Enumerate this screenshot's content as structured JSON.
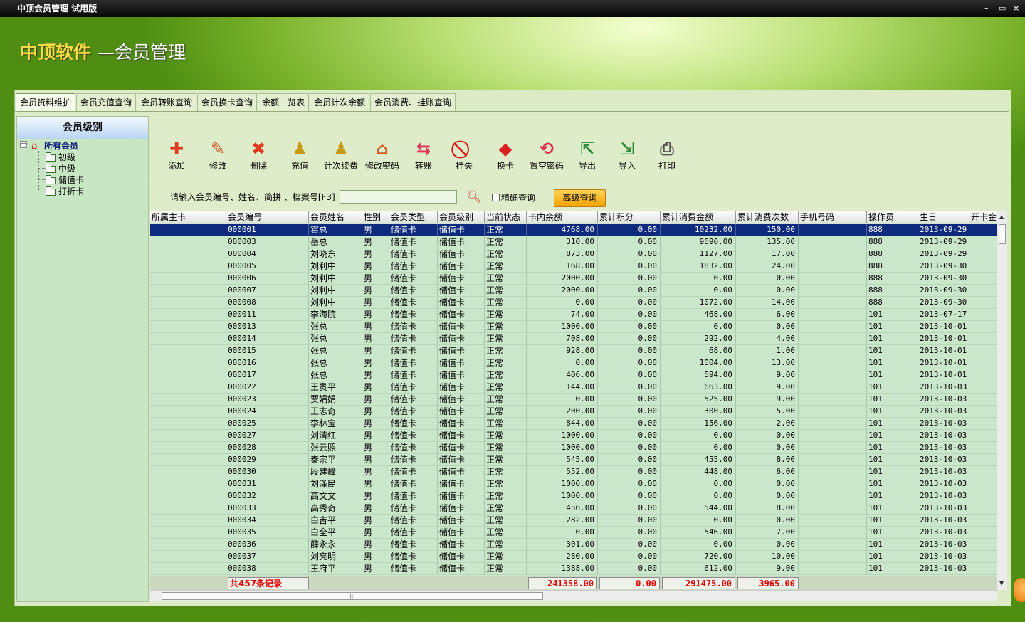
{
  "window": {
    "title": "中顶会员管理  试用版",
    "controls": [
      "–",
      "▭",
      "×"
    ]
  },
  "banner": {
    "brand": "中顶软件",
    "subtitle": "—会员管理"
  },
  "tabs": [
    "会员资料维护",
    "会员充值查询",
    "会员转账查询",
    "会员换卡查询",
    "余额一览表",
    "会员计次余额",
    "会员消费、挂账查询"
  ],
  "sidebar": {
    "title": "会员级别",
    "root": "所有会员",
    "children": [
      "初级",
      "中级",
      "储值卡",
      "打折卡"
    ]
  },
  "toolbar": [
    {
      "label": "添加",
      "icon": "add-icon",
      "color": "#e03b1e",
      "glyph": "✚"
    },
    {
      "label": "修改",
      "icon": "wrench-icon",
      "color": "#cc5522",
      "glyph": "✎"
    },
    {
      "label": "删除",
      "icon": "delete-x-icon",
      "color": "#e03b1e",
      "glyph": "✖"
    },
    {
      "label": "充值",
      "icon": "recharge-icon",
      "color": "#c89a10",
      "glyph": "♟"
    },
    {
      "label": "计次续费",
      "icon": "count-renew-icon",
      "color": "#c89a10",
      "glyph": "♟"
    },
    {
      "label": "修改密码",
      "icon": "home-key-icon",
      "color": "#d05a20",
      "glyph": "⌂"
    },
    {
      "label": "转账",
      "icon": "transfer-icon",
      "color": "#e03050",
      "glyph": "⇆"
    },
    {
      "label": "挂失",
      "icon": "report-loss-icon",
      "color": "#d81818",
      "glyph": "⃠"
    },
    {
      "label": "换卡",
      "icon": "swap-card-icon",
      "color": "#d82020",
      "glyph": "◆"
    },
    {
      "label": "置空密码",
      "icon": "clear-password-icon",
      "color": "#e03050",
      "glyph": "⟲"
    },
    {
      "label": "导出",
      "icon": "export-icon",
      "color": "#2e8b3a",
      "glyph": "⇱"
    },
    {
      "label": "导入",
      "icon": "import-icon",
      "color": "#2e8b3a",
      "glyph": "⇲"
    },
    {
      "label": "打印",
      "icon": "printer-icon",
      "color": "#555555",
      "glyph": "⎙"
    }
  ],
  "search": {
    "prompt": "请输入会员编号、姓名、简拼 、档案号[F3]",
    "value": "",
    "exact_label": "精确查询",
    "advanced_label": "高级查询"
  },
  "table": {
    "columns": [
      "所属主卡",
      "会员编号",
      "会员姓名",
      "性别",
      "会员类型",
      "会员级别",
      "当前状态",
      "卡内余额",
      "累计积分",
      "累计消费金额",
      "累计消费次数",
      "手机号码",
      "操作员",
      "生日",
      "开卡金"
    ],
    "rows": [
      [
        "",
        "000001",
        "霍总",
        "男",
        "储值卡",
        "储值卡",
        "正常",
        "4768.00",
        "0.00",
        "10232.00",
        "150.00",
        "",
        "888",
        "2013-09-29",
        ""
      ],
      [
        "",
        "000003",
        "岳总",
        "男",
        "储值卡",
        "储值卡",
        "正常",
        "310.00",
        "0.00",
        "9690.00",
        "135.00",
        "",
        "888",
        "2013-09-29",
        ""
      ],
      [
        "",
        "000004",
        "刘晓东",
        "男",
        "储值卡",
        "储值卡",
        "正常",
        "873.00",
        "0.00",
        "1127.00",
        "17.00",
        "",
        "888",
        "2013-09-29",
        ""
      ],
      [
        "",
        "000005",
        "刘利中",
        "男",
        "储值卡",
        "储值卡",
        "正常",
        "168.00",
        "0.00",
        "1832.00",
        "24.00",
        "",
        "888",
        "2013-09-30",
        ""
      ],
      [
        "",
        "000006",
        "刘利中",
        "男",
        "储值卡",
        "储值卡",
        "正常",
        "2000.00",
        "0.00",
        "0.00",
        "0.00",
        "",
        "888",
        "2013-09-30",
        ""
      ],
      [
        "",
        "000007",
        "刘利中",
        "男",
        "储值卡",
        "储值卡",
        "正常",
        "2000.00",
        "0.00",
        "0.00",
        "0.00",
        "",
        "888",
        "2013-09-30",
        ""
      ],
      [
        "",
        "000008",
        "刘利中",
        "男",
        "储值卡",
        "储值卡",
        "正常",
        "0.00",
        "0.00",
        "1072.00",
        "14.00",
        "",
        "888",
        "2013-09-30",
        ""
      ],
      [
        "",
        "000011",
        "李海院",
        "男",
        "储值卡",
        "储值卡",
        "正常",
        "74.00",
        "0.00",
        "468.00",
        "6.00",
        "",
        "101",
        "2013-07-17",
        ""
      ],
      [
        "",
        "000013",
        "张总",
        "男",
        "储值卡",
        "储值卡",
        "正常",
        "1000.00",
        "0.00",
        "0.00",
        "0.00",
        "",
        "101",
        "2013-10-01",
        ""
      ],
      [
        "",
        "000014",
        "张总",
        "男",
        "储值卡",
        "储值卡",
        "正常",
        "708.00",
        "0.00",
        "292.00",
        "4.00",
        "",
        "101",
        "2013-10-01",
        ""
      ],
      [
        "",
        "000015",
        "张总",
        "男",
        "储值卡",
        "储值卡",
        "正常",
        "928.00",
        "0.00",
        "68.00",
        "1.00",
        "",
        "101",
        "2013-10-01",
        ""
      ],
      [
        "",
        "000016",
        "张总",
        "男",
        "储值卡",
        "储值卡",
        "正常",
        "0.00",
        "0.00",
        "1004.00",
        "13.00",
        "",
        "101",
        "2013-10-01",
        ""
      ],
      [
        "",
        "000017",
        "张总",
        "男",
        "储值卡",
        "储值卡",
        "正常",
        "406.00",
        "0.00",
        "594.00",
        "9.00",
        "",
        "101",
        "2013-10-01",
        ""
      ],
      [
        "",
        "000022",
        "王贵平",
        "男",
        "储值卡",
        "储值卡",
        "正常",
        "144.00",
        "0.00",
        "663.00",
        "9.00",
        "",
        "101",
        "2013-10-03",
        ""
      ],
      [
        "",
        "000023",
        "贾娟娟",
        "男",
        "储值卡",
        "储值卡",
        "正常",
        "0.00",
        "0.00",
        "525.00",
        "9.00",
        "",
        "101",
        "2013-10-03",
        ""
      ],
      [
        "",
        "000024",
        "王志奇",
        "男",
        "储值卡",
        "储值卡",
        "正常",
        "200.00",
        "0.00",
        "300.00",
        "5.00",
        "",
        "101",
        "2013-10-03",
        ""
      ],
      [
        "",
        "000025",
        "李林宝",
        "男",
        "储值卡",
        "储值卡",
        "正常",
        "844.00",
        "0.00",
        "156.00",
        "2.00",
        "",
        "101",
        "2013-10-03",
        ""
      ],
      [
        "",
        "000027",
        "刘清红",
        "男",
        "储值卡",
        "储值卡",
        "正常",
        "1000.00",
        "0.00",
        "0.00",
        "0.00",
        "",
        "101",
        "2013-10-03",
        ""
      ],
      [
        "",
        "000028",
        "张云照",
        "男",
        "储值卡",
        "储值卡",
        "正常",
        "1000.00",
        "0.00",
        "0.00",
        "0.00",
        "",
        "101",
        "2013-10-03",
        ""
      ],
      [
        "",
        "000029",
        "秦宗平",
        "男",
        "储值卡",
        "储值卡",
        "正常",
        "545.00",
        "0.00",
        "455.00",
        "8.00",
        "",
        "101",
        "2013-10-03",
        ""
      ],
      [
        "",
        "000030",
        "段建峰",
        "男",
        "储值卡",
        "储值卡",
        "正常",
        "552.00",
        "0.00",
        "448.00",
        "6.00",
        "",
        "101",
        "2013-10-03",
        ""
      ],
      [
        "",
        "000031",
        "刘泽民",
        "男",
        "储值卡",
        "储值卡",
        "正常",
        "1000.00",
        "0.00",
        "0.00",
        "0.00",
        "",
        "101",
        "2013-10-03",
        ""
      ],
      [
        "",
        "000032",
        "高文文",
        "男",
        "储值卡",
        "储值卡",
        "正常",
        "1000.00",
        "0.00",
        "0.00",
        "0.00",
        "",
        "101",
        "2013-10-03",
        ""
      ],
      [
        "",
        "000033",
        "高秀奇",
        "男",
        "储值卡",
        "储值卡",
        "正常",
        "456.00",
        "0.00",
        "544.00",
        "8.00",
        "",
        "101",
        "2013-10-03",
        ""
      ],
      [
        "",
        "000034",
        "白吉平",
        "男",
        "储值卡",
        "储值卡",
        "正常",
        "282.00",
        "0.00",
        "0.00",
        "0.00",
        "",
        "101",
        "2013-10-03",
        ""
      ],
      [
        "",
        "000035",
        "白全平",
        "男",
        "储值卡",
        "储值卡",
        "正常",
        "0.00",
        "0.00",
        "546.00",
        "7.00",
        "",
        "101",
        "2013-10-03",
        ""
      ],
      [
        "",
        "000036",
        "薛永永",
        "男",
        "储值卡",
        "储值卡",
        "正常",
        "301.00",
        "0.00",
        "0.00",
        "0.00",
        "",
        "101",
        "2013-10-03",
        ""
      ],
      [
        "",
        "000037",
        "刘亮明",
        "男",
        "储值卡",
        "储值卡",
        "正常",
        "280.00",
        "0.00",
        "720.00",
        "10.00",
        "",
        "101",
        "2013-10-03",
        ""
      ],
      [
        "",
        "000038",
        "王府平",
        "男",
        "储值卡",
        "储值卡",
        "正常",
        "1388.00",
        "0.00",
        "612.00",
        "9.00",
        "",
        "101",
        "2013-10-03",
        ""
      ]
    ],
    "selected_row": 0,
    "footer": {
      "record_count": "共457条记录",
      "balance_total": "241358.00",
      "points_total": "0.00",
      "spend_total": "291475.00",
      "count_total": "3965.00"
    }
  },
  "colors": {
    "selected_row": "#0d2a7c",
    "grid_bg": "#cbe7cb",
    "footer_text": "#e00000",
    "advanced_button": "#f5a300"
  }
}
